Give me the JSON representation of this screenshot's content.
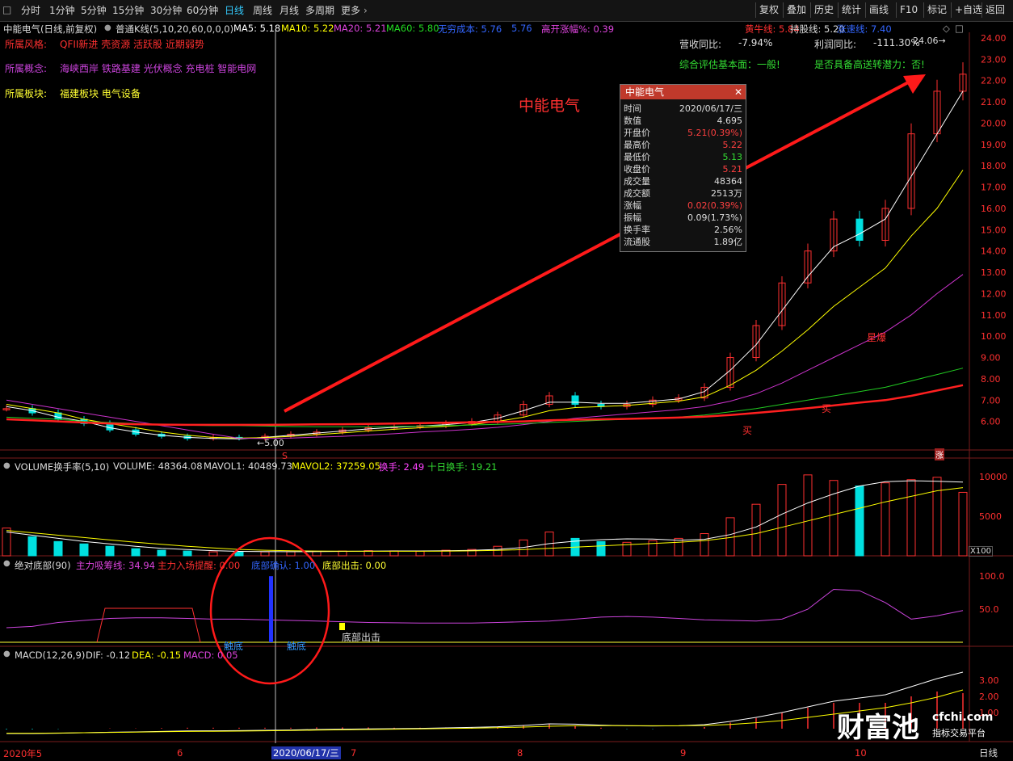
{
  "toolbar": {
    "left": [
      "分时",
      "1分钟",
      "5分钟",
      "15分钟",
      "30分钟",
      "60分钟",
      "日线",
      "周线",
      "月线",
      "多周期",
      "更多"
    ],
    "active": "日线",
    "right": [
      "复权",
      "叠加",
      "历史",
      "统计",
      "画线",
      "F10",
      "标记",
      "+自选",
      "返回"
    ]
  },
  "header": {
    "name": "中能电气(日线,前复权)",
    "k_type": "普通K线(5,10,20,60,0,0,0)",
    "ma5": "MA5: 5.18",
    "ma10": "MA10: 5.22",
    "ma20": "MA20: 5.21",
    "ma60": "MA60: 5.80",
    "cost": "无穷成本: 5.76",
    "cost2": "5.76",
    "gap": "高开涨幅%: 0.39",
    "bull": "黄牛线: 5.84",
    "hold": "持股线: 5.20",
    "trend": "涨速线: 7.40"
  },
  "info": {
    "style_label": "所属风格:",
    "style_val": "QFII新进 壳资源 活跃股 近期弱势",
    "concept_label": "所属概念:",
    "concept_val": "海峡西岸 铁路基建 光伏概念 充电桩 智能电网",
    "sector_label": "所属板块:",
    "sector_val": "福建板块   电气设备",
    "rev_label": "营收同比:",
    "rev_val": "-7.94%",
    "profit_label": "利润同比:",
    "profit_val": "-111.30%",
    "eval": "综合评估基本面：一般!",
    "transfer": "是否具备高送转潜力：否!",
    "big_title": "中能电气"
  },
  "popup": {
    "title": "中能电气",
    "rows": [
      {
        "k": "时间",
        "v": "2020/06/17/三",
        "c": "#ddd"
      },
      {
        "k": "数值",
        "v": "4.695",
        "c": "#ddd"
      },
      {
        "k": "开盘价",
        "v": "5.21(0.39%)",
        "c": "#ff4040"
      },
      {
        "k": "最高价",
        "v": "5.22",
        "c": "#ff4040"
      },
      {
        "k": "最低价",
        "v": "5.13",
        "c": "#33dd33"
      },
      {
        "k": "收盘价",
        "v": "5.21",
        "c": "#ff4040"
      },
      {
        "k": "成交量",
        "v": "48364",
        "c": "#ddd"
      },
      {
        "k": "成交额",
        "v": "2513万",
        "c": "#ddd"
      },
      {
        "k": "涨幅",
        "v": "0.02(0.39%)",
        "c": "#ff4040"
      },
      {
        "k": "振幅",
        "v": "0.09(1.73%)",
        "c": "#ddd"
      },
      {
        "k": "换手率",
        "v": "2.56%",
        "c": "#ddd"
      },
      {
        "k": "流通股",
        "v": "1.89亿",
        "c": "#ddd"
      }
    ]
  },
  "volume_header": {
    "name": "VOLUME换手率(5,10)",
    "vol": "VOLUME: 48364.08",
    "m1": "MAVOL1: 40489.73",
    "m2": "MAVOL2: 37259.05",
    "turn": "换手: 2.49",
    "turn10": "十日换手: 19.21"
  },
  "bottom_header": {
    "name": "绝对底部(90)",
    "a": "主力吸筹线: 34.94",
    "b": "主力入场提醒: 0.00",
    "c": "底部确认: 1.00",
    "d": "底部出击: 0.00"
  },
  "macd_header": {
    "name": "MACD(12,26,9)",
    "dif": "DIF: -0.12",
    "dea": "DEA: -0.15",
    "macd": "MACD: 0.05"
  },
  "annotations": {
    "low_mark": "5.00",
    "high_mark": "24.06",
    "touch1": "触底",
    "touch2": "触底",
    "attack": "底部出击",
    "buy1": "买",
    "buy2": "买",
    "burst": "星爆",
    "s_mark": "S",
    "zhang": "涨"
  },
  "xaxis": {
    "labels": [
      "2020年5",
      "6",
      "7",
      "8",
      "9",
      "10"
    ],
    "cursor_date": "2020/06/17/三",
    "period": "日线"
  },
  "watermark": {
    "brand": "财富池",
    "site": "cfchi.com",
    "slogan": "指标交易平台"
  },
  "colors": {
    "up": "#ff3030",
    "down": "#00e0e0",
    "ma5": "#ffffff",
    "ma10": "#ffff00",
    "ma20": "#cc33cc",
    "ma60": "#22cc22",
    "bull": "#ff2020",
    "bg": "#000000"
  },
  "chart_data": [
    {
      "type": "candlestick",
      "title": "中能电气(日线,前复权)",
      "ylim": [
        5,
        24.5
      ],
      "yticks": [
        6,
        7,
        8,
        9,
        10,
        11,
        12,
        13,
        14,
        15,
        16,
        17,
        18,
        19,
        20,
        21,
        22,
        23,
        24
      ],
      "x": [
        "2020-05",
        "2020-06",
        "2020-07",
        "2020-08",
        "2020-09",
        "2020-10"
      ],
      "close": [
        6.6,
        6.4,
        6.1,
        5.9,
        5.6,
        5.4,
        5.3,
        5.2,
        5.25,
        5.21,
        5.3,
        5.4,
        5.5,
        5.6,
        5.7,
        5.75,
        5.8,
        5.9,
        6.0,
        6.3,
        6.8,
        7.2,
        6.8,
        6.7,
        6.8,
        7.0,
        7.1,
        7.6,
        9.0,
        10.5,
        12.5,
        14.0,
        15.5,
        14.5,
        16.0,
        19.5,
        21.5,
        22.3
      ],
      "series": [
        {
          "name": "MA5",
          "values": [
            6.7,
            6.5,
            6.2,
            6.0,
            5.7,
            5.5,
            5.35,
            5.25,
            5.2,
            5.18,
            5.25,
            5.35,
            5.45,
            5.55,
            5.65,
            5.72,
            5.78,
            5.85,
            5.95,
            6.15,
            6.5,
            6.9,
            6.9,
            6.85,
            6.85,
            6.95,
            7.05,
            7.4,
            8.4,
            9.6,
            11.2,
            12.8,
            14.2,
            14.8,
            15.5,
            17.5,
            19.5,
            21.5
          ]
        },
        {
          "name": "MA10",
          "values": [
            6.8,
            6.6,
            6.4,
            6.1,
            5.9,
            5.7,
            5.5,
            5.35,
            5.25,
            5.22,
            5.24,
            5.3,
            5.38,
            5.46,
            5.55,
            5.63,
            5.7,
            5.77,
            5.85,
            6.0,
            6.2,
            6.5,
            6.65,
            6.7,
            6.75,
            6.85,
            6.95,
            7.15,
            7.7,
            8.4,
            9.3,
            10.3,
            11.4,
            12.3,
            13.2,
            14.7,
            16.0,
            17.8
          ]
        },
        {
          "name": "MA20",
          "values": [
            7.0,
            6.8,
            6.6,
            6.4,
            6.2,
            6.0,
            5.8,
            5.6,
            5.4,
            5.21,
            5.2,
            5.22,
            5.26,
            5.3,
            5.36,
            5.42,
            5.5,
            5.56,
            5.63,
            5.72,
            5.85,
            6.0,
            6.15,
            6.25,
            6.35,
            6.45,
            6.55,
            6.7,
            6.95,
            7.3,
            7.8,
            8.4,
            9.0,
            9.6,
            10.2,
            11.0,
            12.0,
            12.9
          ]
        },
        {
          "name": "MA60",
          "values": [
            6.2,
            6.15,
            6.1,
            6.0,
            5.95,
            5.9,
            5.85,
            5.82,
            5.8,
            5.8,
            5.78,
            5.76,
            5.75,
            5.75,
            5.75,
            5.76,
            5.78,
            5.8,
            5.83,
            5.86,
            5.9,
            5.95,
            6.0,
            6.05,
            6.1,
            6.15,
            6.2,
            6.3,
            6.45,
            6.6,
            6.8,
            7.0,
            7.2,
            7.4,
            7.6,
            7.9,
            8.2,
            8.5
          ]
        },
        {
          "name": "黄牛线",
          "values": [
            6.1,
            6.05,
            6.0,
            5.95,
            5.9,
            5.87,
            5.85,
            5.84,
            5.84,
            5.84,
            5.84,
            5.85,
            5.86,
            5.87,
            5.88,
            5.9,
            5.92,
            5.94,
            5.96,
            5.98,
            6.0,
            6.05,
            6.08,
            6.1,
            6.12,
            6.15,
            6.18,
            6.22,
            6.3,
            6.4,
            6.5,
            6.62,
            6.75,
            6.88,
            7.0,
            7.2,
            7.45,
            7.7
          ]
        }
      ]
    },
    {
      "type": "bar",
      "title": "VOLUME换手率(5,10)",
      "ylim": [
        0,
        11000
      ],
      "yticks": [
        5000,
        10000
      ],
      "values": [
        3500,
        2400,
        1800,
        1500,
        1200,
        900,
        700,
        600,
        500,
        480,
        500,
        520,
        560,
        600,
        650,
        620,
        580,
        700,
        800,
        1200,
        2000,
        3000,
        2200,
        1800,
        1700,
        1900,
        2200,
        2800,
        4800,
        6500,
        9000,
        10200,
        9500,
        8800,
        9200,
        9600,
        9900,
        8000
      ],
      "series": [
        {
          "name": "MAVOL1",
          "values": [
            3000,
            2600,
            2200,
            1800,
            1500,
            1200,
            950,
            780,
            650,
            560,
            530,
            520,
            530,
            560,
            590,
            610,
            610,
            630,
            680,
            800,
            1060,
            1540,
            1840,
            2040,
            2140,
            2120,
            1960,
            2080,
            2680,
            3640,
            5260,
            6660,
            7800,
            8800,
            9340,
            9460,
            9400,
            9300
          ]
        },
        {
          "name": "MAVOL2",
          "values": [
            3200,
            2900,
            2600,
            2300,
            2000,
            1700,
            1450,
            1200,
            1000,
            800,
            700,
            640,
            600,
            580,
            570,
            570,
            570,
            590,
            620,
            680,
            780,
            950,
            1100,
            1250,
            1400,
            1550,
            1700,
            1900,
            2300,
            2800,
            3600,
            4400,
            5200,
            6000,
            6800,
            7500,
            8200,
            8600
          ]
        }
      ]
    },
    {
      "type": "line",
      "title": "绝对底部(90)",
      "ylim": [
        0,
        110
      ],
      "yticks": [
        50,
        100
      ],
      "series": [
        {
          "name": "主力吸筹线",
          "values": [
            22,
            24,
            30,
            33,
            36,
            37,
            37,
            36,
            35,
            34.9,
            34,
            33,
            32,
            31,
            30,
            29.5,
            29,
            29,
            29,
            30,
            31,
            32,
            35,
            38,
            39,
            38,
            36,
            34,
            33,
            32,
            35,
            50,
            80,
            78,
            60,
            35,
            40,
            48
          ]
        }
      ],
      "bars": [
        {
          "name": "底部确认",
          "value": 100
        },
        {
          "name": "底部出击",
          "value": 20
        }
      ]
    },
    {
      "type": "line",
      "title": "MACD(12,26,9)",
      "ylim": [
        -0.5,
        4
      ],
      "yticks": [
        1,
        2,
        3
      ],
      "series": [
        {
          "name": "DIF",
          "values": [
            -0.3,
            -0.3,
            -0.28,
            -0.25,
            -0.22,
            -0.2,
            -0.17,
            -0.14,
            -0.13,
            -0.12,
            -0.1,
            -0.08,
            -0.05,
            -0.03,
            -0.01,
            0.0,
            0.02,
            0.05,
            0.08,
            0.12,
            0.2,
            0.3,
            0.28,
            0.22,
            0.18,
            0.17,
            0.18,
            0.25,
            0.45,
            0.7,
            1.0,
            1.35,
            1.7,
            1.9,
            2.1,
            2.6,
            3.1,
            3.5
          ]
        },
        {
          "name": "DEA",
          "values": [
            -0.28,
            -0.28,
            -0.27,
            -0.25,
            -0.23,
            -0.21,
            -0.19,
            -0.17,
            -0.16,
            -0.15,
            -0.13,
            -0.11,
            -0.09,
            -0.07,
            -0.05,
            -0.03,
            -0.01,
            0.01,
            0.03,
            0.06,
            0.1,
            0.15,
            0.18,
            0.19,
            0.19,
            0.18,
            0.18,
            0.2,
            0.26,
            0.37,
            0.5,
            0.7,
            0.9,
            1.1,
            1.3,
            1.6,
            1.95,
            2.4
          ]
        }
      ]
    }
  ]
}
